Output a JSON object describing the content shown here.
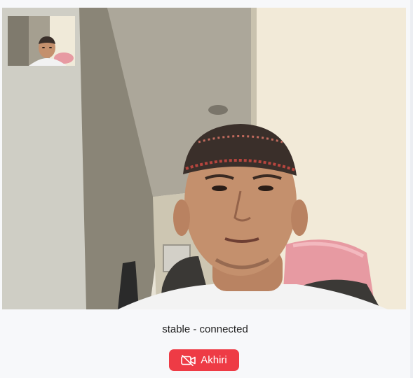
{
  "call": {
    "status_text": "stable - connected",
    "end_button_label": "Akhiri",
    "end_button_icon": "video-off-icon",
    "accent_color": "#ee3b45"
  }
}
